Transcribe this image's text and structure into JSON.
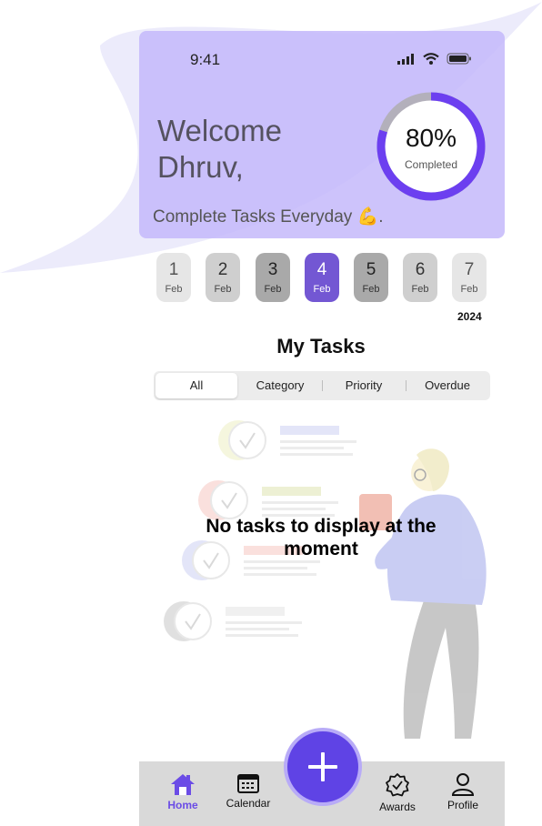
{
  "status_bar": {
    "time": "9:41"
  },
  "header": {
    "welcome_line1": "Welcome",
    "welcome_line2": "Dhruv,",
    "progress_percent": 80,
    "progress_text": "80%",
    "progress_label": "Completed",
    "motto": "Complete Tasks Everyday 💪."
  },
  "dates": [
    {
      "day": "1",
      "month": "Feb",
      "state": "light"
    },
    {
      "day": "2",
      "month": "Feb",
      "state": "mid"
    },
    {
      "day": "3",
      "month": "Feb",
      "state": "dark"
    },
    {
      "day": "4",
      "month": "Feb",
      "state": "selected"
    },
    {
      "day": "5",
      "month": "Feb",
      "state": "dark"
    },
    {
      "day": "6",
      "month": "Feb",
      "state": "mid"
    },
    {
      "day": "7",
      "month": "Feb",
      "state": "light"
    }
  ],
  "year": "2024",
  "section_title": "My Tasks",
  "tabs": [
    {
      "label": "All",
      "active": true
    },
    {
      "label": "Category",
      "active": false
    },
    {
      "label": "Priority",
      "active": false
    },
    {
      "label": "Overdue",
      "active": false
    }
  ],
  "empty_message": "No tasks to display at the moment",
  "nav": {
    "home": "Home",
    "calendar": "Calendar",
    "awards": "Awards",
    "profile": "Profile"
  },
  "colors": {
    "accent": "#5f43e5",
    "header_bg": "#c4b8fa",
    "selected_date": "#7357d3"
  },
  "icons": {
    "status": [
      "signal-icon",
      "wifi-icon",
      "battery-icon"
    ],
    "fab": "plus-icon",
    "nav": [
      "home-icon",
      "calendar-icon",
      "award-icon",
      "user-icon"
    ]
  }
}
